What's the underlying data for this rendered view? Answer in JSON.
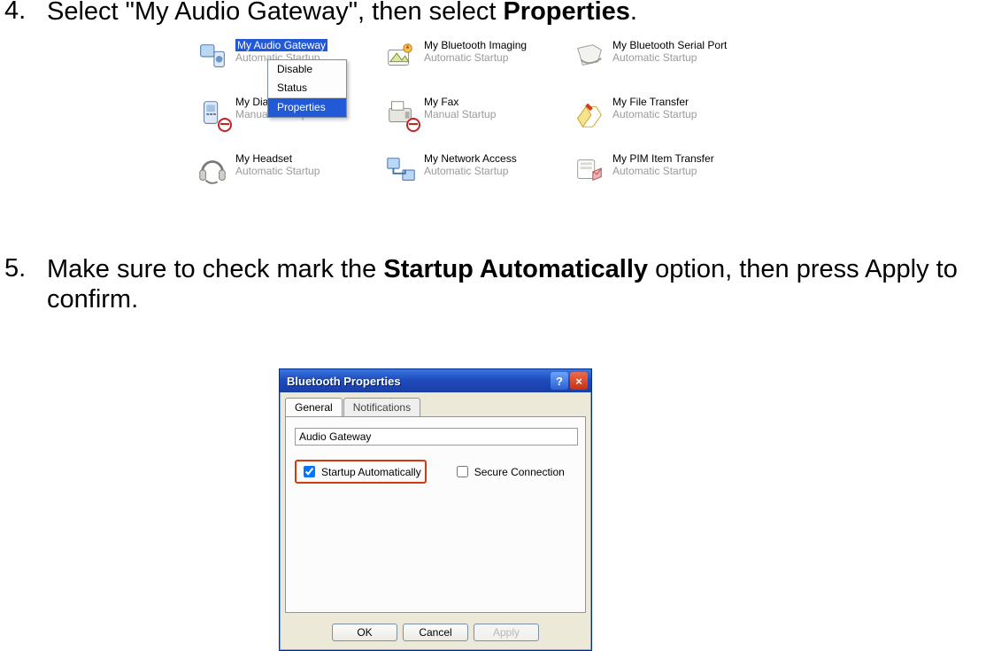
{
  "steps": {
    "s4_num": "4.",
    "s4_a": "Select \"My Audio Gateway\", then select ",
    "s4_strong": "Properties",
    "s4_b": ".",
    "s5_num": "5.",
    "s5_a": "Make sure to check mark the ",
    "s5_strong": "Startup Automatically",
    "s5_b": " option, then press Apply to confirm."
  },
  "services": [
    {
      "name": "My Audio Gateway",
      "status": "Automatic Startup",
      "selected": true
    },
    {
      "name": "My Bluetooth Imaging",
      "status": "Automatic Startup"
    },
    {
      "name": "My Bluetooth Serial Port",
      "status": "Automatic Startup"
    },
    {
      "name": "My Dial-up",
      "status": "Manual Startup",
      "nobadge": true
    },
    {
      "name": "My Fax",
      "status": "Manual Startup",
      "nobadge": true
    },
    {
      "name": "My File Transfer",
      "status": "Automatic Startup"
    },
    {
      "name": "My Headset",
      "status": "Automatic Startup"
    },
    {
      "name": "My Network Access",
      "status": "Automatic Startup"
    },
    {
      "name": "My PIM Item Transfer",
      "status": "Automatic Startup"
    }
  ],
  "context_menu": {
    "disable": "Disable",
    "status": "Status",
    "properties": "Properties"
  },
  "dialog": {
    "title": "Bluetooth Properties",
    "help": "?",
    "close": "×",
    "tab_general": "General",
    "tab_notifications": "Notifications",
    "field_value": "Audio Gateway",
    "chk_startup": "Startup Automatically",
    "chk_secure": "Secure Connection",
    "btn_ok": "OK",
    "btn_cancel": "Cancel",
    "btn_apply": "Apply"
  }
}
